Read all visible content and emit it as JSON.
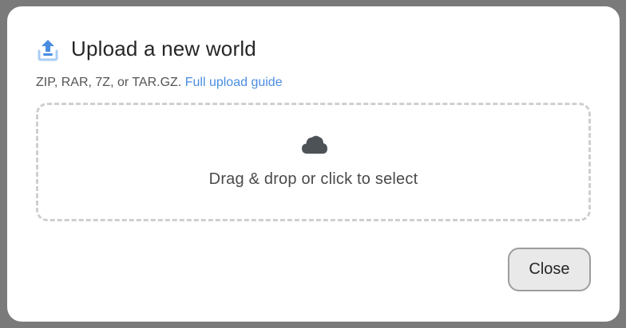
{
  "modal": {
    "title": "Upload a new world",
    "title_icon": "upload-icon",
    "formats_text": "ZIP, RAR, 7Z, or TAR.GZ.",
    "guide_link_label": "Full upload guide",
    "dropzone": {
      "icon": "cloud-icon",
      "label": "Drag & drop or click to select"
    },
    "close_label": "Close"
  },
  "colors": {
    "accent": "#4a8de0",
    "icon_light_blue": "#a9cdf3",
    "cloud_gray": "#4d5257"
  }
}
